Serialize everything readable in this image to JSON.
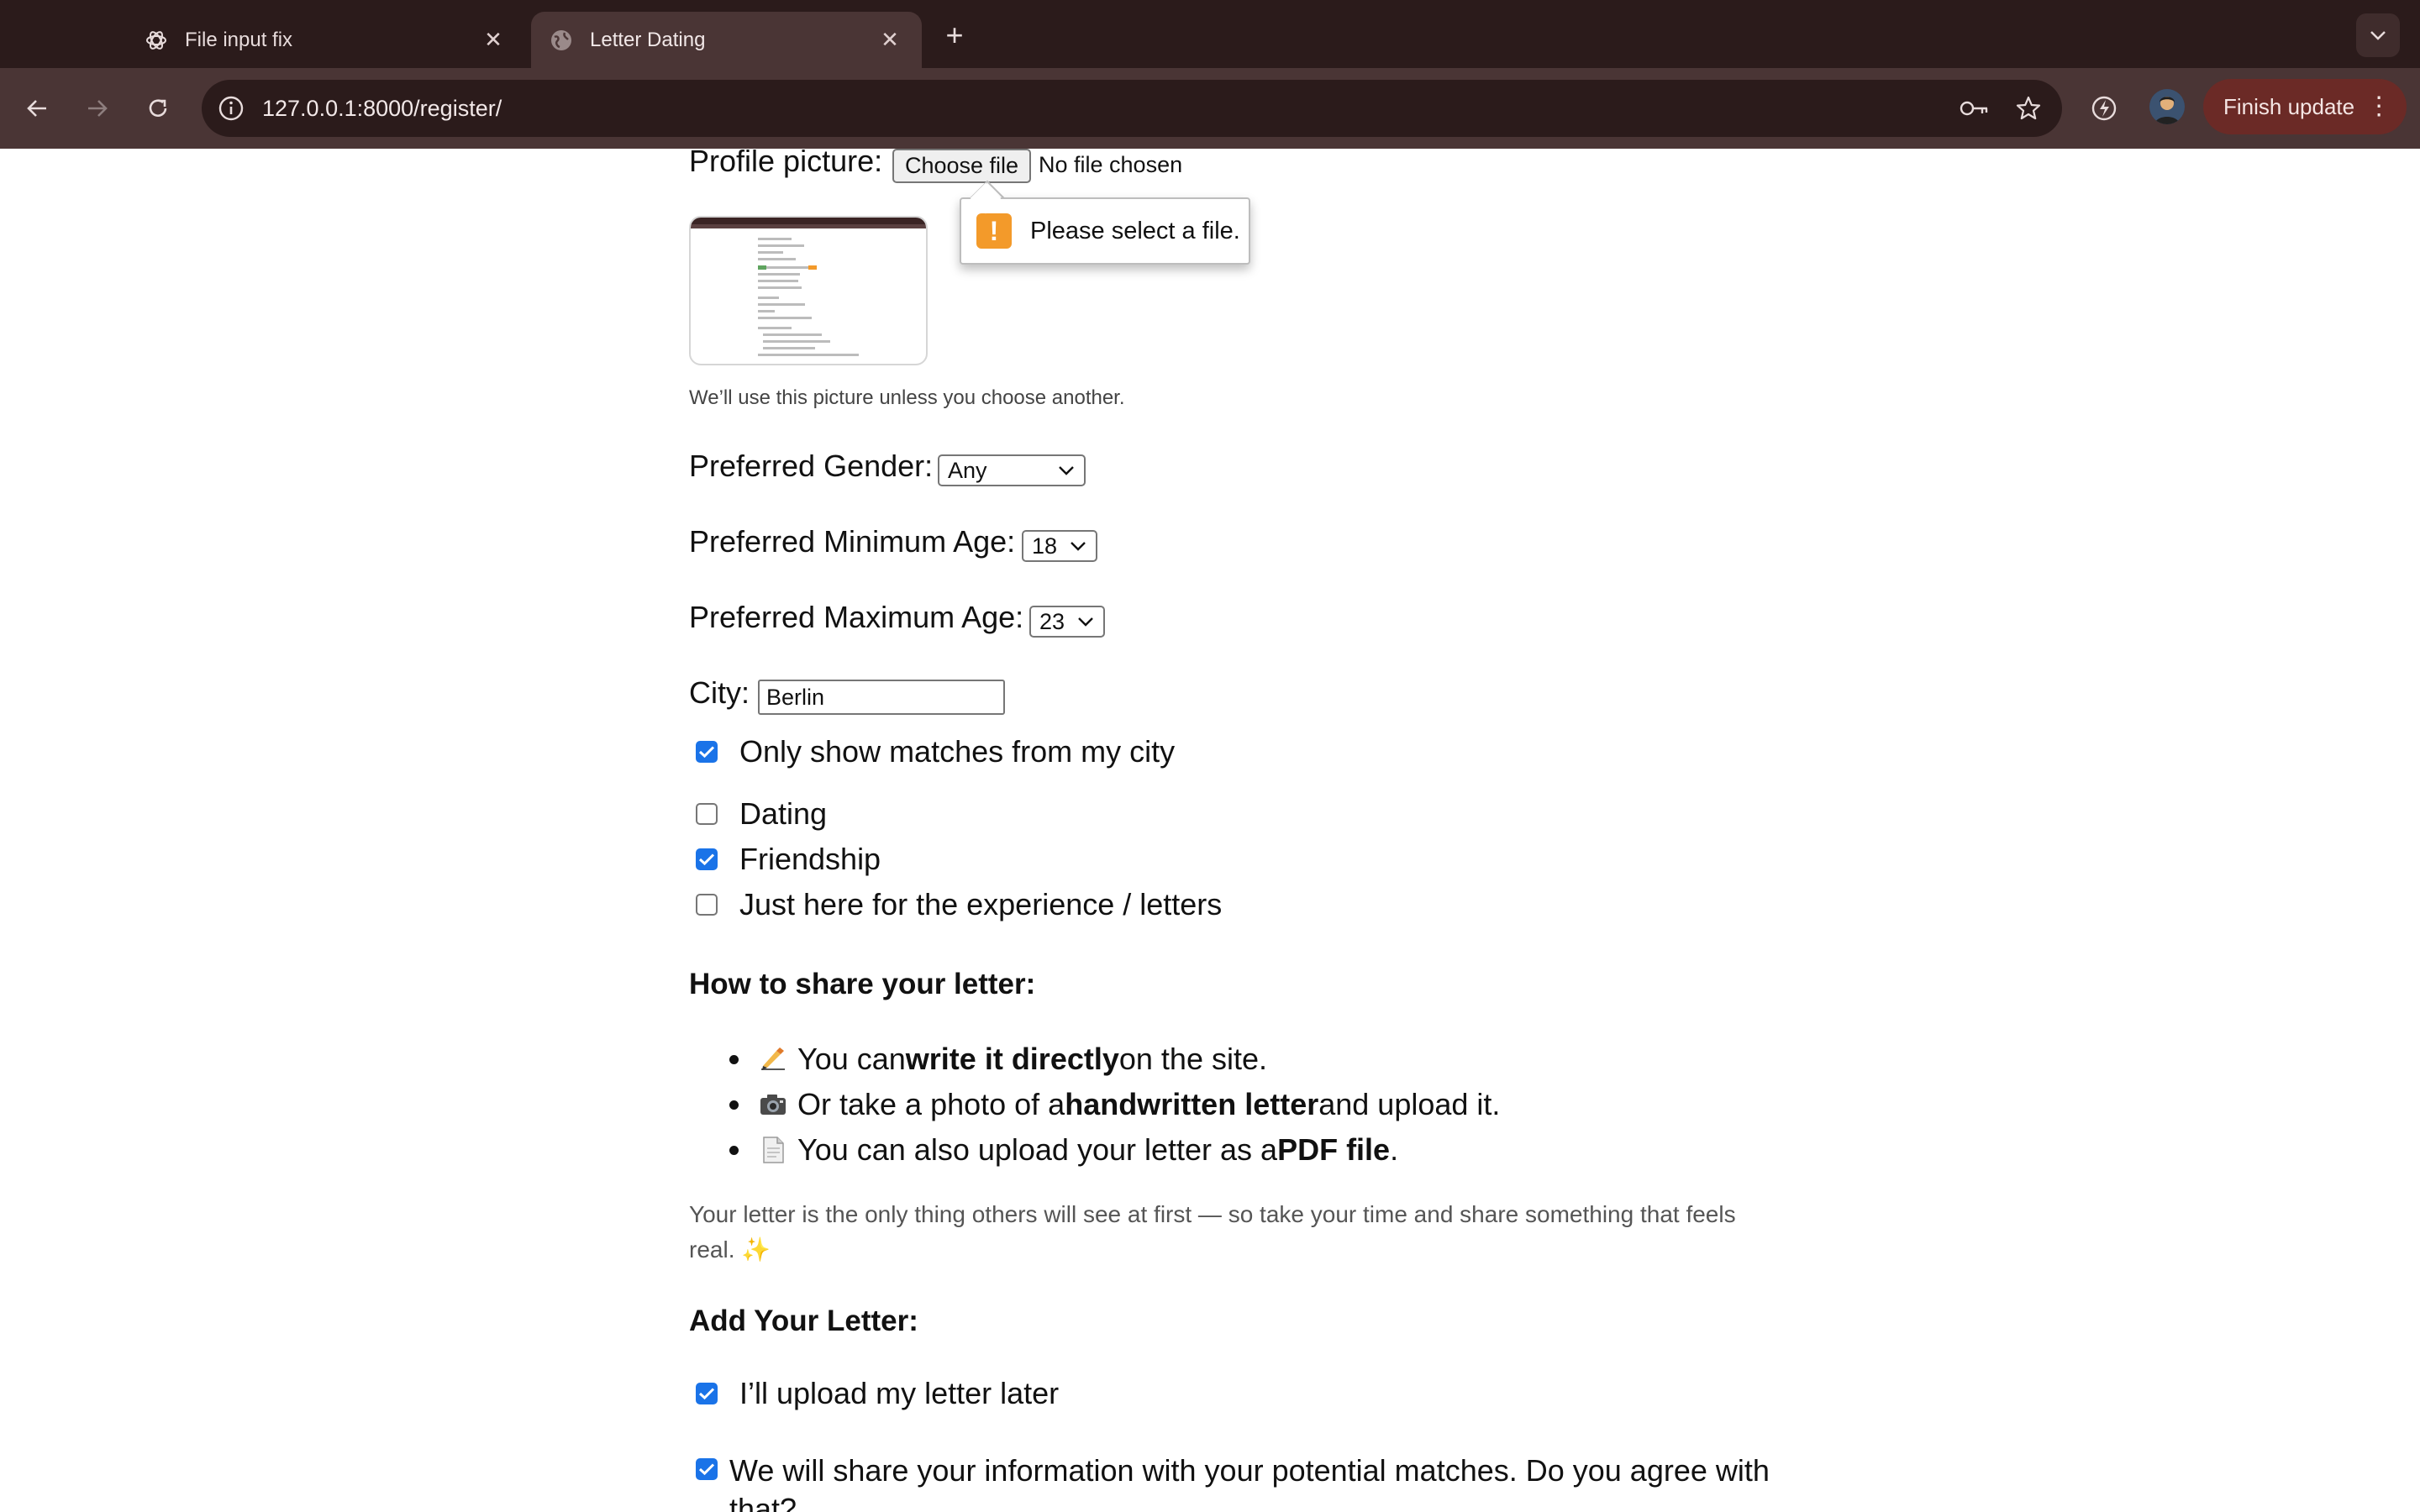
{
  "browser": {
    "tabs": [
      {
        "title": "File input fix",
        "active": false
      },
      {
        "title": "Letter Dating",
        "active": true
      }
    ],
    "url": "127.0.0.1:8000/register/",
    "update_button": "Finish update"
  },
  "form": {
    "profile_picture": {
      "label": "Profile picture:",
      "choose_button": "Choose file",
      "status": "No file chosen",
      "validation_message": "Please select a file.",
      "hint": "We’ll use this picture unless you choose another."
    },
    "preferred_gender": {
      "label": "Preferred Gender:",
      "value": "Any"
    },
    "preferred_min_age": {
      "label": "Preferred Minimum Age:",
      "value": "18"
    },
    "preferred_max_age": {
      "label": "Preferred Maximum Age:",
      "value": "23"
    },
    "city": {
      "label": "City:",
      "value": "Berlin"
    },
    "only_city": {
      "label": "Only show matches from my city",
      "checked": true
    },
    "intentions": [
      {
        "label": "Dating",
        "checked": false
      },
      {
        "label": "Friendship",
        "checked": true
      },
      {
        "label": "Just here for the experience / letters",
        "checked": false
      }
    ],
    "share_heading": "How to share your letter:",
    "share_items": [
      {
        "icon": "writing-hand-icon",
        "before": "You can ",
        "bold": "write it directly",
        "after": " on the site."
      },
      {
        "icon": "camera-icon",
        "before": "Or take a photo of a ",
        "bold": "handwritten letter",
        "after": " and upload it."
      },
      {
        "icon": "document-icon",
        "before": "You can also upload your letter as a ",
        "bold": "PDF file",
        "after": "."
      }
    ],
    "share_note": "Your letter is the only thing others will see at first — so take your time and share something that feels real.",
    "share_note_emoji": "✨",
    "add_letter_heading": "Add Your Letter:",
    "upload_later": {
      "label": "I’ll upload my letter later",
      "checked": true
    },
    "consent": {
      "label": "We will share your information with your potential matches. Do you agree with that?",
      "checked": true
    }
  },
  "colors": {
    "accent": "#1a73e8",
    "warning": "#f39a2a",
    "tabbar": "#2b1b1b",
    "toolbar": "#4a3535"
  }
}
